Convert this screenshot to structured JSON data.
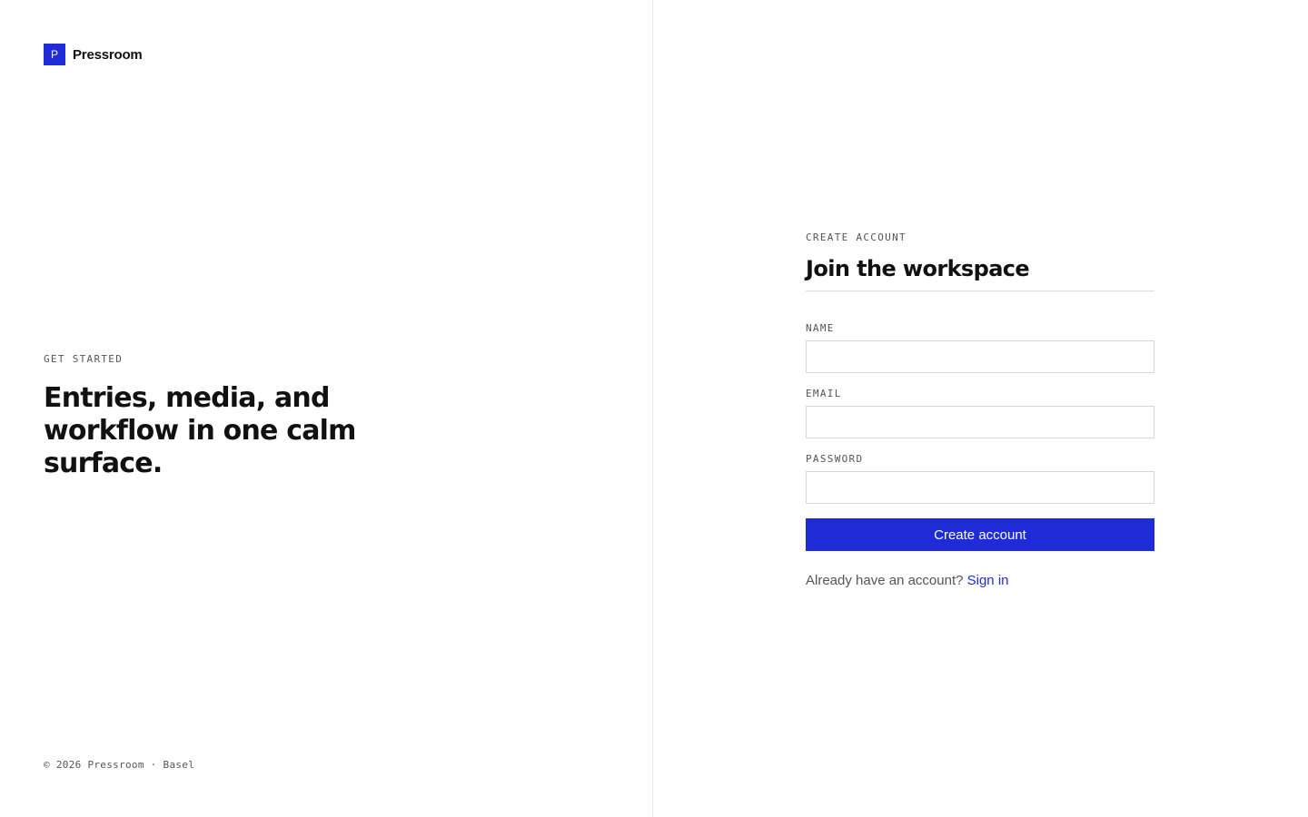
{
  "brand": {
    "mark": "P",
    "name": "Pressroom"
  },
  "hero": {
    "eyebrow": "GET STARTED",
    "title": "Entries, media, and workflow in one calm surface."
  },
  "footer": {
    "text": "© 2026 Pressroom · Basel"
  },
  "form": {
    "eyebrow": "CREATE ACCOUNT",
    "title": "Join the workspace",
    "fields": [
      {
        "label": "NAME",
        "value": "",
        "placeholder": ""
      },
      {
        "label": "EMAIL",
        "value": "",
        "placeholder": ""
      },
      {
        "label": "PASSWORD",
        "value": "",
        "placeholder": ""
      }
    ],
    "submit_label": "Create account",
    "signin_prompt": "Already have an account?",
    "signin_link": "Sign in"
  },
  "colors": {
    "accent": "#1f2bd6",
    "text": "#111111",
    "muted": "#555555",
    "border": "#d6d6d6"
  }
}
